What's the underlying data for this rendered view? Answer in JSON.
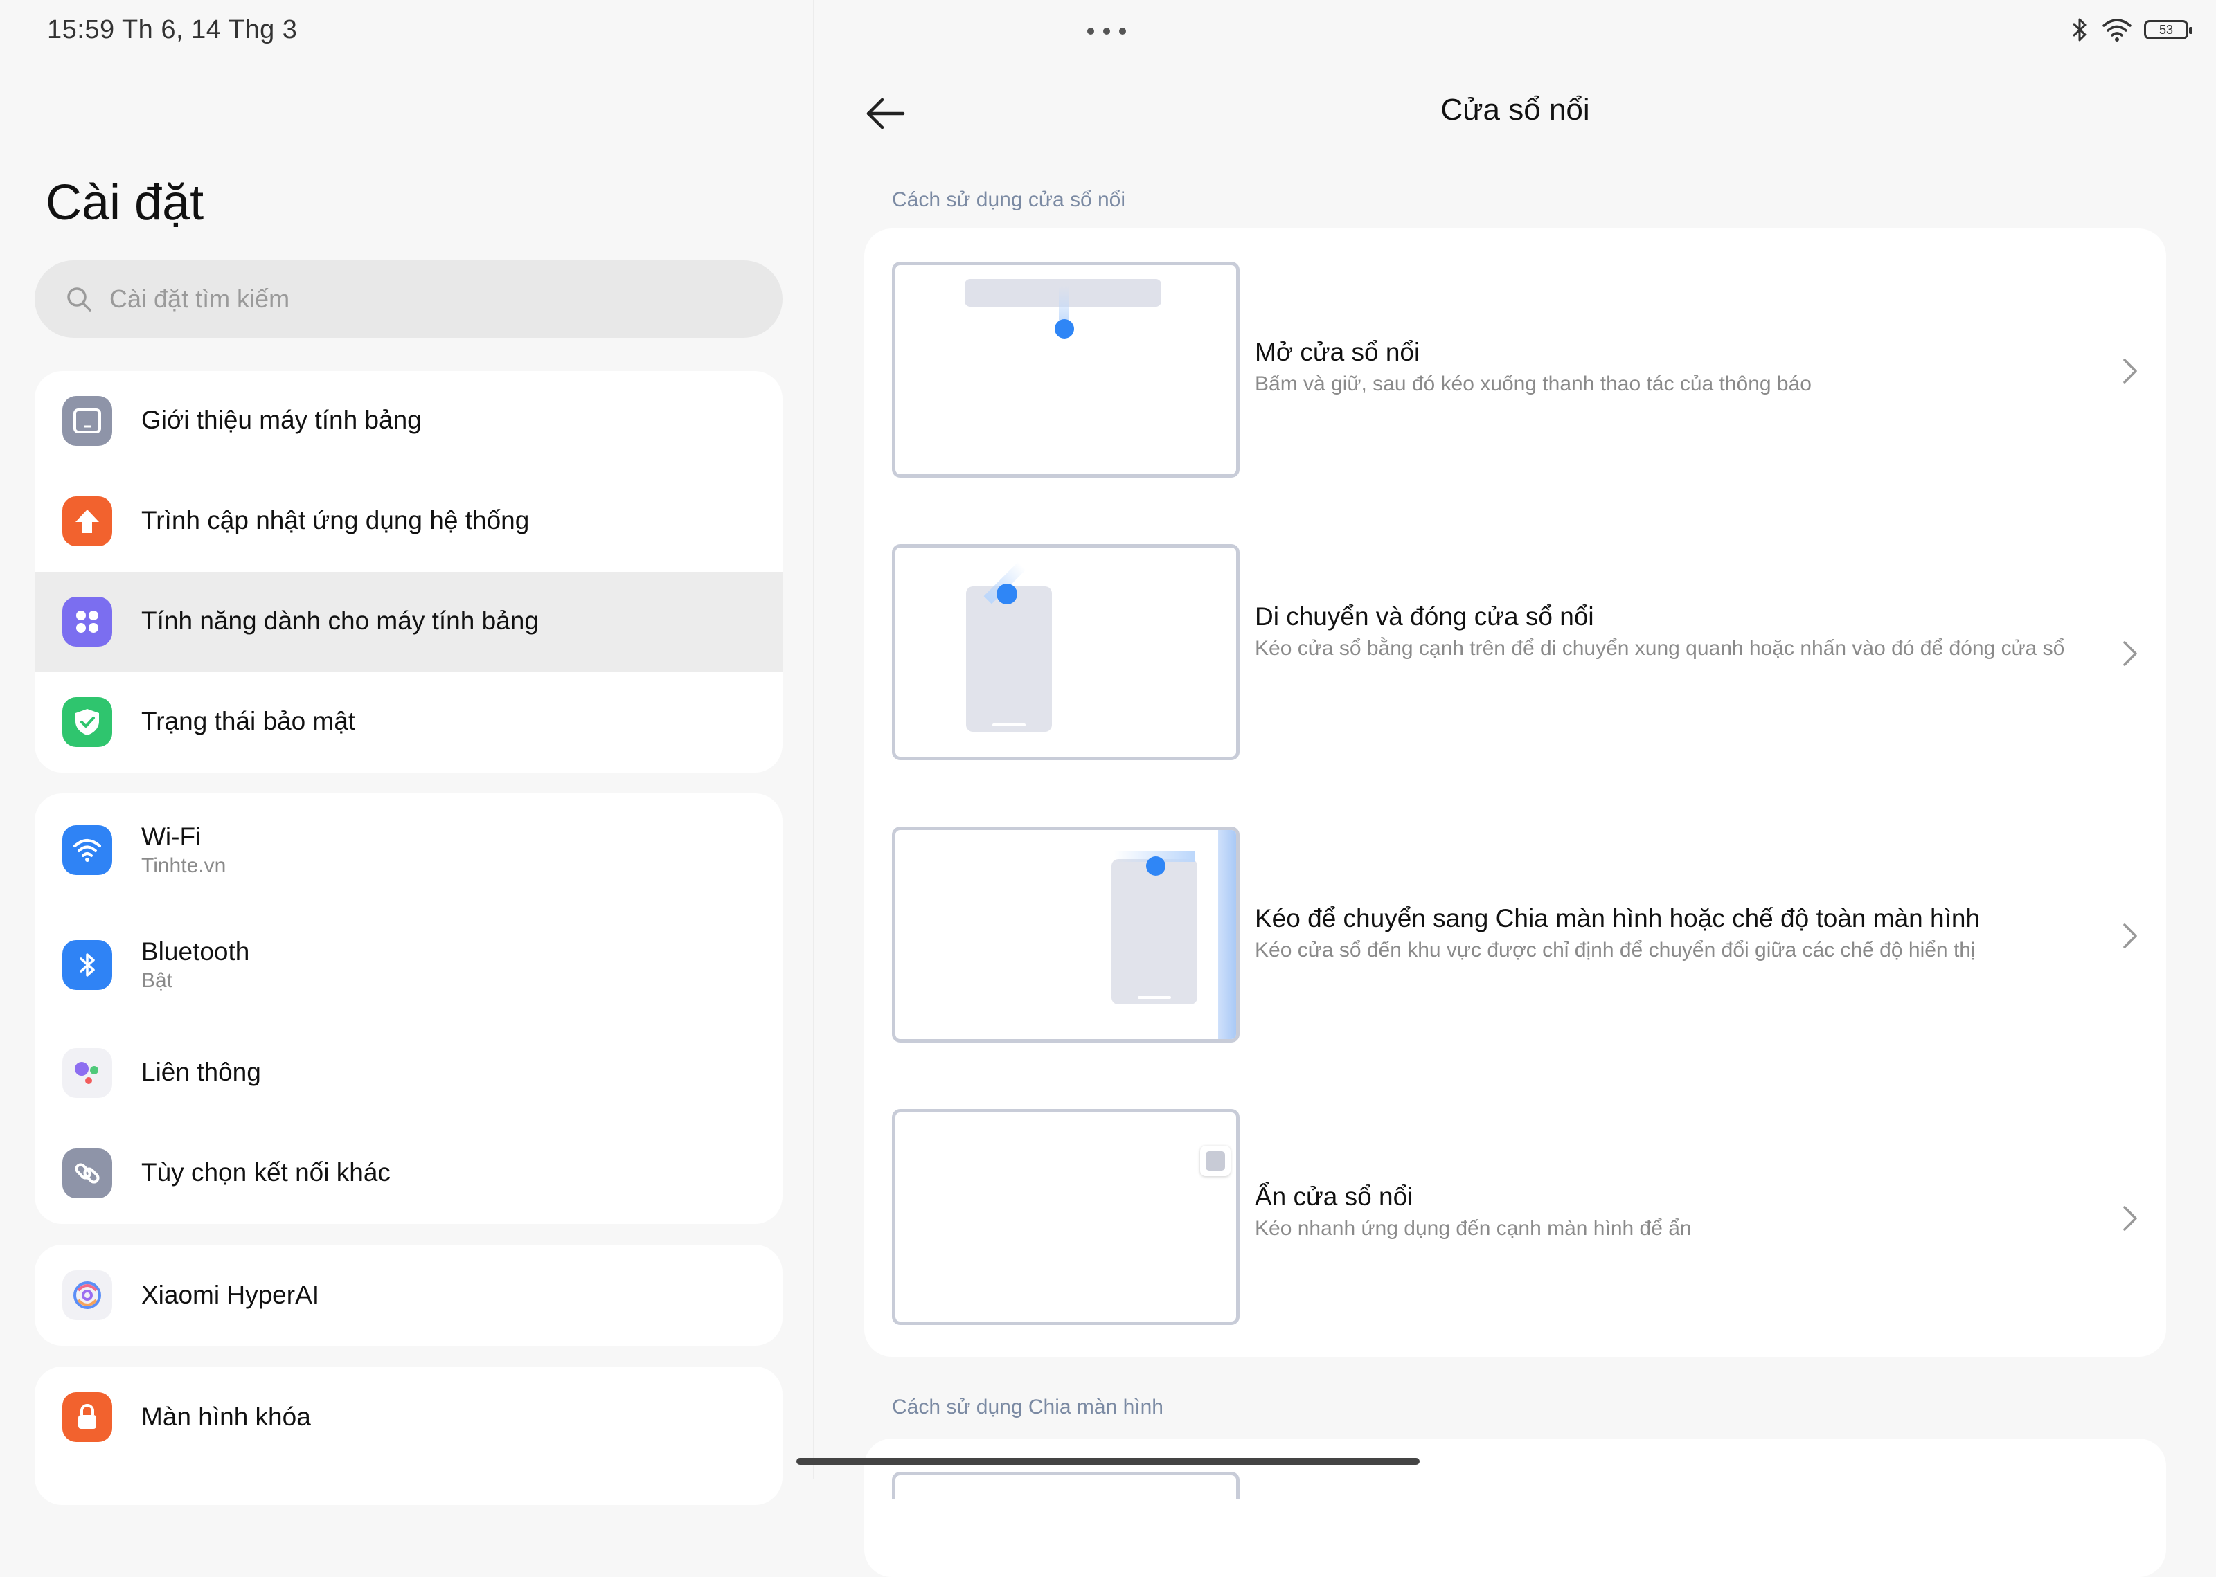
{
  "status": {
    "time_date": "15:59   Th 6, 14 Thg 3",
    "battery": "53",
    "more_dots": "•••"
  },
  "left": {
    "title": "Cài đặt",
    "search_placeholder": "Cài đặt tìm kiếm",
    "group1": [
      {
        "label": "Giới thiệu máy tính bảng",
        "icon": "tablet-icon",
        "color": "#8e94a8"
      },
      {
        "label": "Trình cập nhật ứng dụng hệ thống",
        "icon": "update-arrow-icon",
        "color": "#f2622e"
      },
      {
        "label": "Tính năng dành cho máy tính bảng",
        "icon": "grid-dots-icon",
        "color": "#7b6ef0",
        "selected": true
      },
      {
        "label": "Trạng thái bảo mật",
        "icon": "shield-check-icon",
        "color": "#2fc56e"
      }
    ],
    "group2": [
      {
        "label": "Wi-Fi",
        "sub": "Tinhte.vn",
        "icon": "wifi-icon",
        "color": "#2f83f5"
      },
      {
        "label": "Bluetooth",
        "sub": "Bật",
        "icon": "bluetooth-icon",
        "color": "#2f83f5"
      },
      {
        "label": "Liên thông",
        "icon": "interconnect-icon",
        "color": "#ffffff"
      },
      {
        "label": "Tùy chọn kết nối khác",
        "icon": "link-icon",
        "color": "#8e94a8"
      }
    ],
    "group3": [
      {
        "label": "Xiaomi HyperAI",
        "icon": "hyperai-icon",
        "color": "#ffffff"
      }
    ],
    "group4": [
      {
        "label": "Màn hình khóa",
        "icon": "lock-icon",
        "color": "#f2622e"
      }
    ]
  },
  "right": {
    "title": "Cửa sổ nổi",
    "section1": "Cách sử dụng cửa sổ nổi",
    "section2": "Cách sử dụng Chia màn hình",
    "rows": [
      {
        "title": "Mở cửa sổ nổi",
        "desc": "Bấm và giữ, sau đó kéo xuống thanh thao tác của thông báo"
      },
      {
        "title": "Di chuyển và đóng cửa sổ nổi",
        "desc": "Kéo cửa sổ bằng cạnh trên để di chuyển xung quanh hoặc nhấn vào đó để đóng cửa sổ"
      },
      {
        "title": "Kéo để chuyển sang Chia màn hình hoặc chế độ toàn màn hình",
        "desc": "Kéo cửa sổ đến khu vực được chỉ định để chuyển đổi giữa các chế độ hiển thị"
      },
      {
        "title": "Ẩn cửa sổ nổi",
        "desc": "Kéo nhanh ứng dụng đến cạnh màn hình để ẩn"
      }
    ]
  }
}
